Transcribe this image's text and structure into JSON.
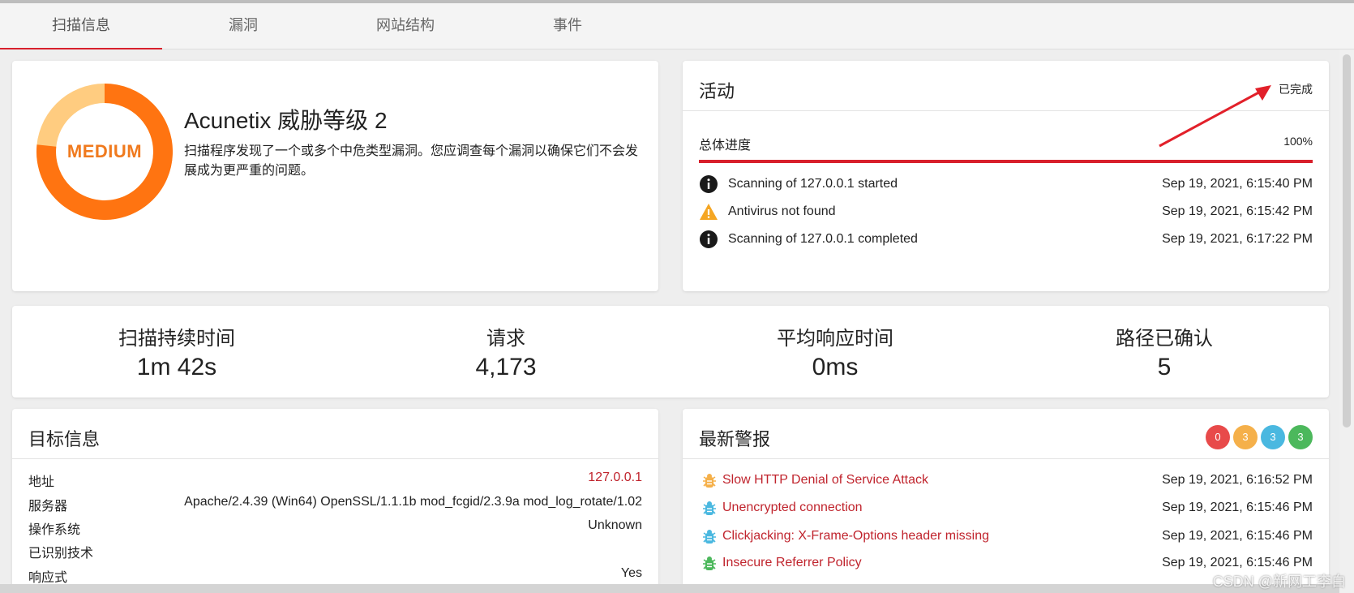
{
  "tabs": [
    {
      "label": "扫描信息"
    },
    {
      "label": "漏洞"
    },
    {
      "label": "网站结构"
    },
    {
      "label": "事件"
    }
  ],
  "threat": {
    "level_label": "MEDIUM",
    "title": "Acunetix 威胁等级 2",
    "description": "扫描程序发现了一个或多个中危类型漏洞。您应调查每个漏洞以确保它们不会发展成为更严重的问题。"
  },
  "activity": {
    "title": "活动",
    "status": "已完成",
    "progress_label": "总体进度",
    "progress_value": "100%",
    "progress_fraction": 1.0,
    "accent_color": "#d8202c",
    "events": [
      {
        "icon": "info-icon",
        "text": "Scanning of 127.0.0.1 started",
        "time": "Sep 19, 2021, 6:15:40 PM"
      },
      {
        "icon": "warning-icon",
        "text": "Antivirus not found",
        "time": "Sep 19, 2021, 6:15:42 PM"
      },
      {
        "icon": "info-icon",
        "text": "Scanning of 127.0.0.1 completed",
        "time": "Sep 19, 2021, 6:17:22 PM"
      }
    ]
  },
  "stats": [
    {
      "label": "扫描持续时间",
      "value": "1m 42s"
    },
    {
      "label": "请求",
      "value": "4,173"
    },
    {
      "label": "平均响应时间",
      "value": "0ms"
    },
    {
      "label": "路径已确认",
      "value": "5"
    }
  ],
  "target": {
    "title": "目标信息",
    "rows": [
      {
        "key": "地址",
        "value": "127.0.0.1"
      },
      {
        "key": "服务器",
        "value": "Apache/2.4.39 (Win64) OpenSSL/1.1.1b mod_fcgid/2.3.9a mod_log_rotate/1.02"
      },
      {
        "key": "操作系统",
        "value": "Unknown"
      },
      {
        "key": "已识别技术",
        "value": ""
      },
      {
        "key": "响应式",
        "value": "Yes"
      }
    ]
  },
  "alerts": {
    "title": "最新警报",
    "badges": [
      {
        "count": "0",
        "color": "#e84a4a"
      },
      {
        "count": "3",
        "color": "#f5b04a"
      },
      {
        "count": "3",
        "color": "#4ab8e0"
      },
      {
        "count": "3",
        "color": "#4cb85c"
      }
    ],
    "items": [
      {
        "name": "Slow HTTP Denial of Service Attack",
        "time": "Sep 19, 2021, 6:16:52 PM",
        "severity_color": "#f5b04a"
      },
      {
        "name": "Unencrypted connection",
        "time": "Sep 19, 2021, 6:15:46 PM",
        "severity_color": "#4ab8e0"
      },
      {
        "name": "Clickjacking: X-Frame-Options header missing",
        "time": "Sep 19, 2021, 6:15:46 PM",
        "severity_color": "#4ab8e0"
      },
      {
        "name": "Insecure Referrer Policy",
        "time": "Sep 19, 2021, 6:15:46 PM",
        "severity_color": "#4cb85c"
      }
    ]
  },
  "watermark": "CSDN @新网工李白"
}
